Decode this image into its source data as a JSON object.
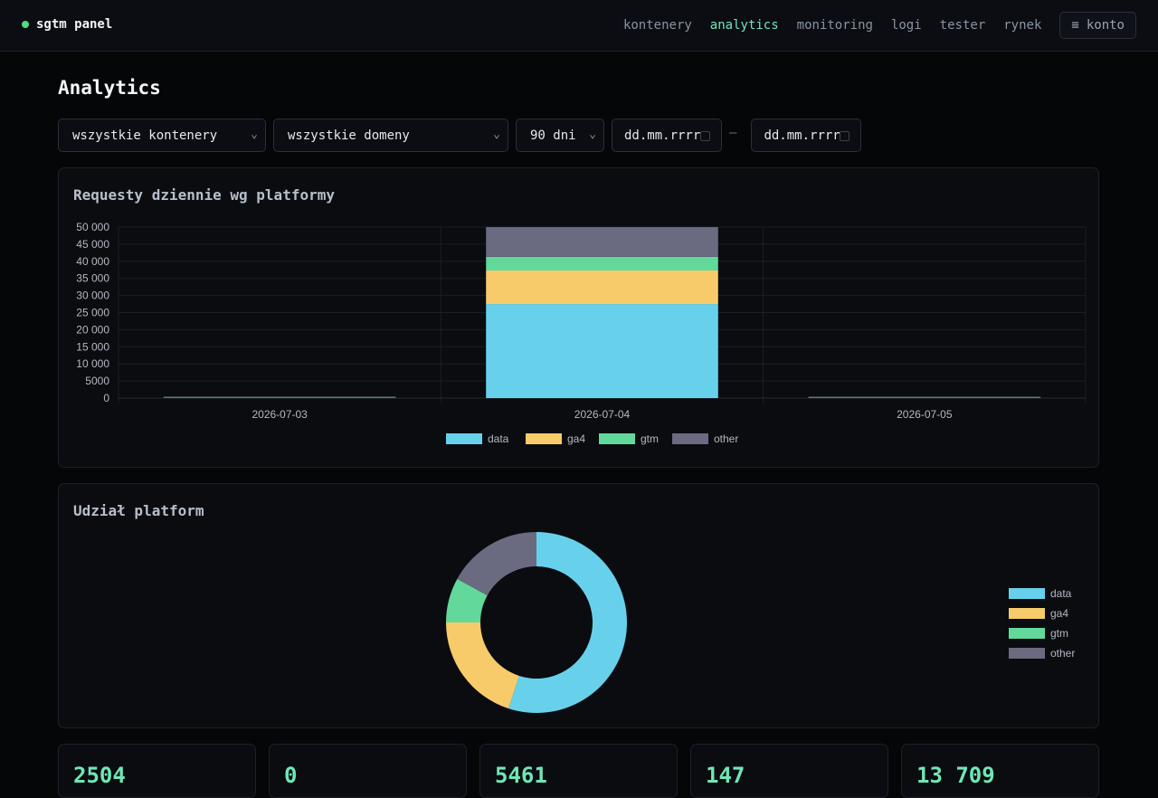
{
  "header": {
    "brand": "sgtm panel",
    "nav": [
      {
        "label": "kontenery",
        "active": false
      },
      {
        "label": "analytics",
        "active": true
      },
      {
        "label": "monitoring",
        "active": false
      },
      {
        "label": "logi",
        "active": false
      },
      {
        "label": "tester",
        "active": false
      },
      {
        "label": "rynek",
        "active": false
      }
    ],
    "account": {
      "icon": "menu-icon",
      "label": "konto"
    }
  },
  "page": {
    "title": "Analytics"
  },
  "filters": {
    "container": "wszystkie kontenery",
    "domain": "wszystkie domeny",
    "range": "90 dni",
    "date_from": "dd.mm.rrrr",
    "date_to": "dd.mm.rrrr",
    "separator": "–"
  },
  "colors": {
    "data": "#67d1ec",
    "ga4": "#f7cb6a",
    "gtm": "#62d89a",
    "other": "#6a6b80",
    "accent": "#6ee7b7"
  },
  "charts": {
    "daily_title": "Requesty dziennie wg platformy",
    "share_title": "Udział platform"
  },
  "chart_data": [
    {
      "type": "bar",
      "stacked": true,
      "title": "Requesty dziennie wg platformy",
      "categories": [
        "2026-07-03",
        "2026-07-04",
        "2026-07-05"
      ],
      "series": [
        {
          "name": "data",
          "values": [
            120,
            27500,
            100
          ]
        },
        {
          "name": "ga4",
          "values": [
            40,
            9800,
            40
          ]
        },
        {
          "name": "gtm",
          "values": [
            20,
            4000,
            20
          ]
        },
        {
          "name": "other",
          "values": [
            20,
            8700,
            20
          ]
        }
      ],
      "ylim": [
        0,
        50000
      ],
      "yticks": [
        "0",
        "5000",
        "10 000",
        "15 000",
        "20 000",
        "25 000",
        "30 000",
        "35 000",
        "40 000",
        "45 000",
        "50 000"
      ],
      "grid": true,
      "legend": "bottom"
    },
    {
      "type": "pie",
      "donut": true,
      "title": "Udział platform",
      "labels": [
        "data",
        "ga4",
        "gtm",
        "other"
      ],
      "values": [
        55,
        20,
        8,
        17
      ],
      "legend": "right"
    }
  ],
  "stats": [
    "2504",
    "0",
    "5461",
    "147",
    "13 709"
  ]
}
